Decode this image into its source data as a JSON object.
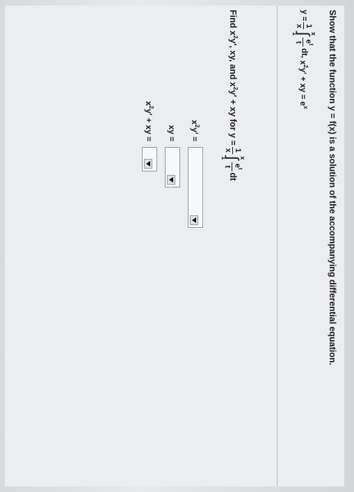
{
  "prompt": "Show that the function y = f(x) is a solution of the accompanying differential equation.",
  "given": {
    "lhs": "y =",
    "frac_num": "1",
    "frac_den": "x",
    "int_upper": "x",
    "int_lower": "1",
    "integrand_num": "e",
    "integrand_num_exp": "t",
    "integrand_den": "t",
    "dt": "dt,",
    "eq_x": "x",
    "eq_exp": "2",
    "eq_rest": "y′ + xy = e",
    "eq_rhs_exp": "x"
  },
  "task": {
    "text_a": "Find x",
    "exp1": "2",
    "text_b": "y′, xy, and x",
    "exp2": "2",
    "text_c": "y′ + xy for y =",
    "frac_num": "1",
    "frac_den": "x",
    "int_upper": "x",
    "int_lower": "1",
    "integrand_num": "e",
    "integrand_num_exp": "t",
    "integrand_den": "t",
    "dt": "dt"
  },
  "answers": [
    {
      "label_x": "x",
      "label_exp": "2",
      "label_rest": "y′ =",
      "value": ""
    },
    {
      "label_x": "",
      "label_exp": "",
      "label_rest": "xy =",
      "value": ""
    },
    {
      "label_x": "x",
      "label_exp": "2",
      "label_rest": "y′ + xy =",
      "value": ""
    }
  ],
  "icons": {
    "dropdown": "triangle-down-icon"
  }
}
